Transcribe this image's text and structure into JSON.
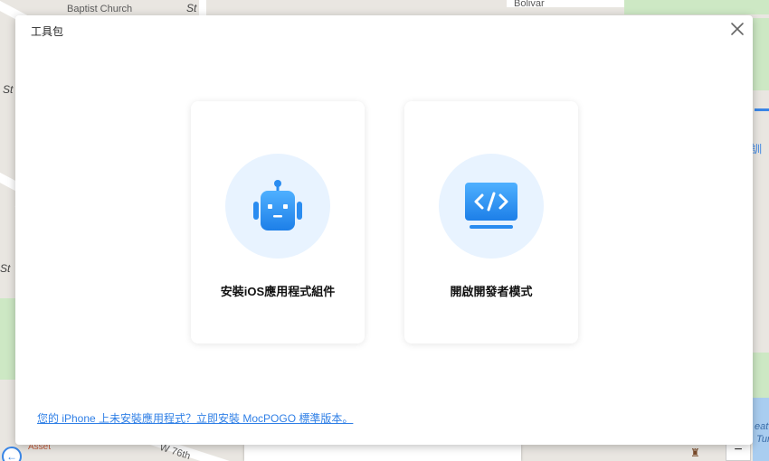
{
  "map": {
    "labels": {
      "church": "Baptist Church",
      "st_top": "St",
      "st_left1": "St",
      "st_left2": "St",
      "asset": "Asset",
      "w76": "W 76th",
      "bolivar": "Bolivar",
      "eat": "eat",
      "turt": "Turt",
      "right_icon": "訓"
    },
    "zoom_label": "−",
    "nav_icon": "arrow-left-icon"
  },
  "dialog": {
    "title": "工具包",
    "close_icon": "close-icon",
    "cards": [
      {
        "label": "安裝iOS應用程式組件",
        "icon": "robot-icon"
      },
      {
        "label": "開啟開發者模式",
        "icon": "code-monitor-icon"
      }
    ],
    "footer_link": "您的 iPhone 上未安裝應用程式？立即安裝 MocPOGO 標準版本。",
    "colors": {
      "accent": "#2f7fe6",
      "icon_bg": "#e8f3ff",
      "icon_blue": "#2a8cf0"
    }
  }
}
